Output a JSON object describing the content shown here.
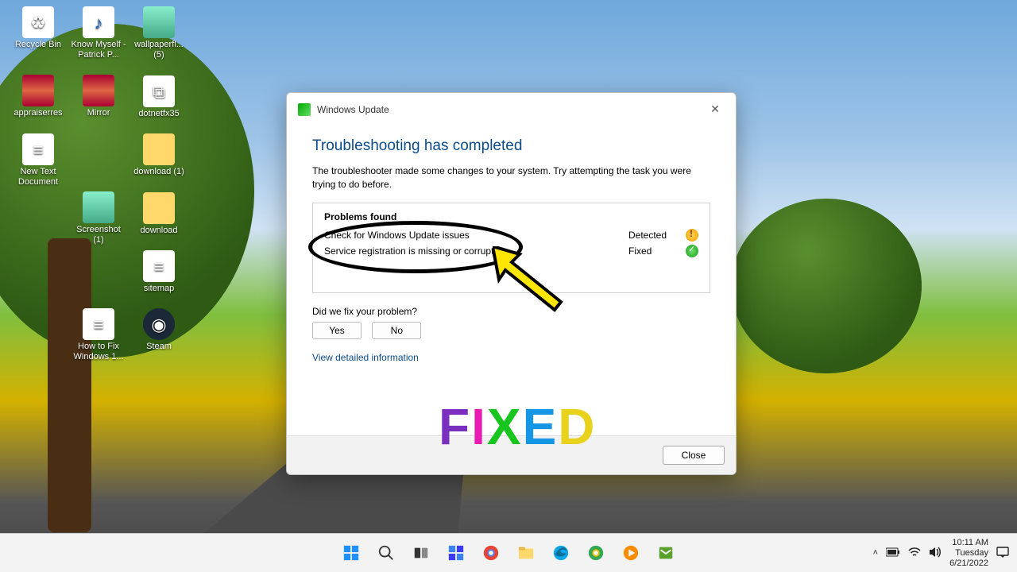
{
  "desktop_icons": [
    {
      "label": "Recycle Bin",
      "kind": "bin",
      "glyph": "♻"
    },
    {
      "label": "Know Myself - Patrick P...",
      "kind": "mp3",
      "glyph": "♪"
    },
    {
      "label": "wallpaperfl... (5)",
      "kind": "pic",
      "glyph": ""
    },
    {
      "label": "appraiserres",
      "kind": "rar",
      "glyph": ""
    },
    {
      "label": "Mirror",
      "kind": "rar",
      "glyph": ""
    },
    {
      "label": "",
      "kind": "spacer",
      "glyph": ""
    },
    {
      "label": "dotnetfx35",
      "kind": "exe",
      "glyph": "⧉"
    },
    {
      "label": "New Text Document",
      "kind": "txt",
      "glyph": "≡"
    },
    {
      "label": "",
      "kind": "spacer",
      "glyph": ""
    },
    {
      "label": "download (1)",
      "kind": "fld",
      "glyph": ""
    },
    {
      "label": "Screenshot (1)",
      "kind": "pic",
      "glyph": ""
    },
    {
      "label": "",
      "kind": "spacer",
      "glyph": ""
    },
    {
      "label": "download",
      "kind": "fld",
      "glyph": ""
    },
    {
      "label": "sitemap",
      "kind": "txt",
      "glyph": "≡"
    },
    {
      "label": "",
      "kind": "spacer",
      "glyph": ""
    },
    {
      "label": "How to Fix Windows 1...",
      "kind": "txt",
      "glyph": "≡"
    },
    {
      "label": "Steam",
      "kind": "steam",
      "glyph": "◉"
    }
  ],
  "dialog": {
    "title": "Windows Update",
    "heading": "Troubleshooting has completed",
    "description": "The troubleshooter made some changes to your system. Try attempting the task you were trying to do before.",
    "problems_header": "Problems found",
    "rows": [
      {
        "label": "Check for Windows Update issues",
        "status": "Detected",
        "icon": "warn"
      },
      {
        "label": "Service registration is missing or corrupt",
        "status": "Fixed",
        "icon": "ok"
      }
    ],
    "question": "Did we fix your problem?",
    "yes": "Yes",
    "no": "No",
    "detail_link": "View detailed information",
    "close": "Close"
  },
  "overlay": {
    "text": "FIXED"
  },
  "taskbar": {
    "items": [
      "start",
      "search",
      "taskview",
      "widgets",
      "chrome",
      "explorer",
      "edge",
      "chrome2",
      "media",
      "mail"
    ]
  },
  "tray": {
    "time": "10:11 AM",
    "day": "Tuesday",
    "date": "6/21/2022"
  }
}
